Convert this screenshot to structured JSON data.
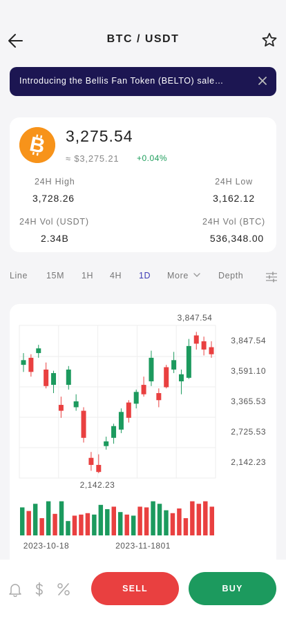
{
  "header": {
    "title": "BTC / USDT",
    "back_icon": "arrow-left-icon",
    "favorite_icon": "star-icon"
  },
  "banner": {
    "text": "Introducing the Bellis Fan Token (BELTO) sale…",
    "close_icon": "close-icon"
  },
  "ticker": {
    "coin_icon": "bitcoin-icon",
    "price": "3,275.54",
    "fiat": "≈ $3,275.21",
    "change": "+0.04%",
    "stats": {
      "high_label": "24H High",
      "high": "3,728.26",
      "low_label": "24H Low",
      "low": "3,162.12",
      "vol_usdt_label": "24H Vol (USDT)",
      "vol_usdt": "2.34B",
      "vol_btc_label": "24H Vol (BTC)",
      "vol_btc": "536,348.00"
    }
  },
  "tabs": [
    "Line",
    "15M",
    "1H",
    "4H",
    "1D",
    "More",
    "Depth"
  ],
  "active_tab": "1D",
  "colors": {
    "up": "#1c9a5e",
    "down": "#e94040",
    "accent": "#3d3ab5",
    "banner": "#1c1652",
    "bitcoin": "#f7931a"
  },
  "chart_data": {
    "type": "candlestick",
    "y_ticks": [
      "3,847.54",
      "3,591.10",
      "3,365.53",
      "2,725.53",
      "2,142.23"
    ],
    "max_label": "3,847.54",
    "min_label": "2,142.23",
    "x_labels": [
      "2023-10-18",
      "2023-11-1801"
    ],
    "candles": [
      {
        "o": 3500,
        "c": 3540,
        "h": 3600,
        "l": 3440
      },
      {
        "o": 3560,
        "c": 3440,
        "h": 3590,
        "l": 3400
      },
      {
        "o": 3600,
        "c": 3640,
        "h": 3670,
        "l": 3560
      },
      {
        "o": 3460,
        "c": 3320,
        "h": 3520,
        "l": 3300
      },
      {
        "o": 3330,
        "c": 3430,
        "h": 3450,
        "l": 3260
      },
      {
        "o": 3160,
        "c": 3110,
        "h": 3230,
        "l": 3050
      },
      {
        "o": 3330,
        "c": 3460,
        "h": 3490,
        "l": 3290
      },
      {
        "o": 3140,
        "c": 3190,
        "h": 3250,
        "l": 3110
      },
      {
        "o": 3110,
        "c": 2880,
        "h": 3140,
        "l": 2840
      },
      {
        "o": 2710,
        "c": 2650,
        "h": 2760,
        "l": 2600
      },
      {
        "o": 2650,
        "c": 2590,
        "h": 2740,
        "l": 2580
      },
      {
        "o": 2810,
        "c": 2850,
        "h": 2890,
        "l": 2780
      },
      {
        "o": 2880,
        "c": 2980,
        "h": 3000,
        "l": 2830
      },
      {
        "o": 2950,
        "c": 3100,
        "h": 3130,
        "l": 2920
      },
      {
        "o": 3180,
        "c": 3050,
        "h": 3200,
        "l": 3010
      },
      {
        "o": 3170,
        "c": 3270,
        "h": 3290,
        "l": 3130
      },
      {
        "o": 3330,
        "c": 3250,
        "h": 3400,
        "l": 3230
      },
      {
        "o": 3360,
        "c": 3560,
        "h": 3620,
        "l": 3320
      },
      {
        "o": 3260,
        "c": 3200,
        "h": 3300,
        "l": 3140
      },
      {
        "o": 3480,
        "c": 3310,
        "h": 3500,
        "l": 3300
      },
      {
        "o": 3460,
        "c": 3540,
        "h": 3610,
        "l": 3430
      },
      {
        "o": 3360,
        "c": 3420,
        "h": 3460,
        "l": 3250
      },
      {
        "o": 3390,
        "c": 3660,
        "h": 3720,
        "l": 3380
      },
      {
        "o": 3750,
        "c": 3680,
        "h": 3780,
        "l": 3630
      },
      {
        "o": 3700,
        "c": 3630,
        "h": 3740,
        "l": 3580
      },
      {
        "o": 3650,
        "c": 3590,
        "h": 3700,
        "l": 3560
      }
    ],
    "volumes": [
      78,
      68,
      88,
      48,
      95,
      60,
      95,
      40,
      55,
      58,
      62,
      58,
      85,
      73,
      80,
      65,
      58,
      55,
      80,
      78,
      95,
      88,
      70,
      62,
      75,
      48,
      95,
      88,
      95,
      80
    ]
  },
  "bottom": {
    "sell_label": "SELL",
    "buy_label": "BUY",
    "icons": [
      "bell-icon",
      "dollar-icon",
      "percent-icon"
    ]
  }
}
